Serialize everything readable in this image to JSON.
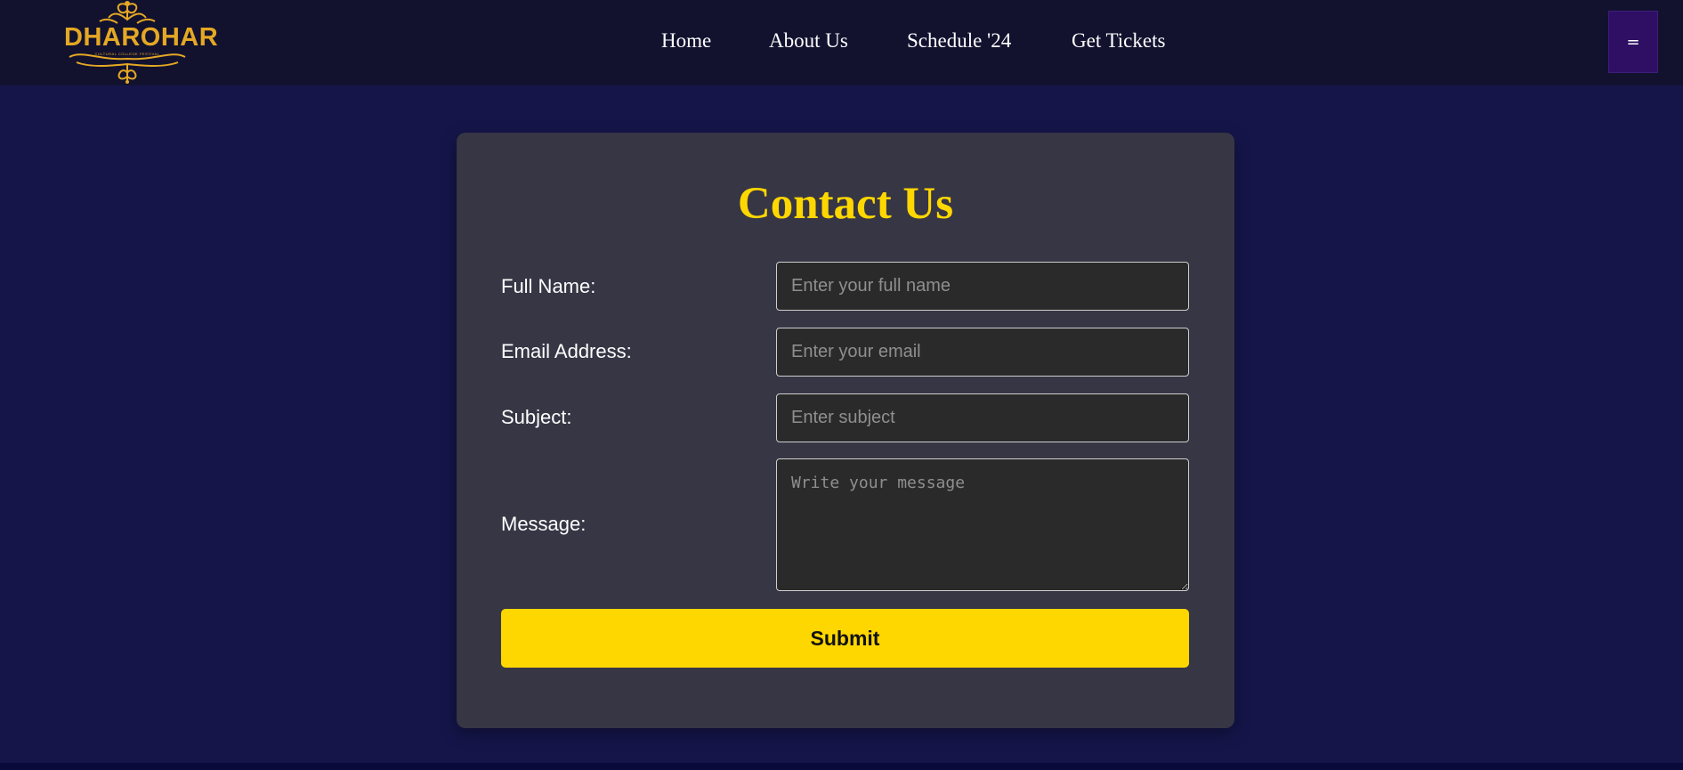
{
  "brand": {
    "logo_text": "DHAROHAR",
    "logo_tagline": "CULTURAL COLLEGE FESTIVAL",
    "color": "#e5a824"
  },
  "nav": {
    "links": [
      {
        "label": "Home"
      },
      {
        "label": "About Us"
      },
      {
        "label": "Schedule '24"
      },
      {
        "label": "Get Tickets"
      }
    ],
    "menu_button_label": "=",
    "menu_icon": "hamburger-icon"
  },
  "form": {
    "title": "Contact Us",
    "fields": {
      "full_name": {
        "label": "Full Name:",
        "placeholder": "Enter your full name",
        "value": ""
      },
      "email": {
        "label": "Email Address:",
        "placeholder": "Enter your email",
        "value": ""
      },
      "subject": {
        "label": "Subject:",
        "placeholder": "Enter subject",
        "value": ""
      },
      "message": {
        "label": "Message:",
        "placeholder": "Write your message",
        "value": ""
      }
    },
    "submit_label": "Submit"
  },
  "colors": {
    "page_background": "#15154a",
    "navbar_background": "#12122f",
    "card_background": "#363645",
    "accent": "#ffd700",
    "menu_button": "#2e0f63"
  }
}
